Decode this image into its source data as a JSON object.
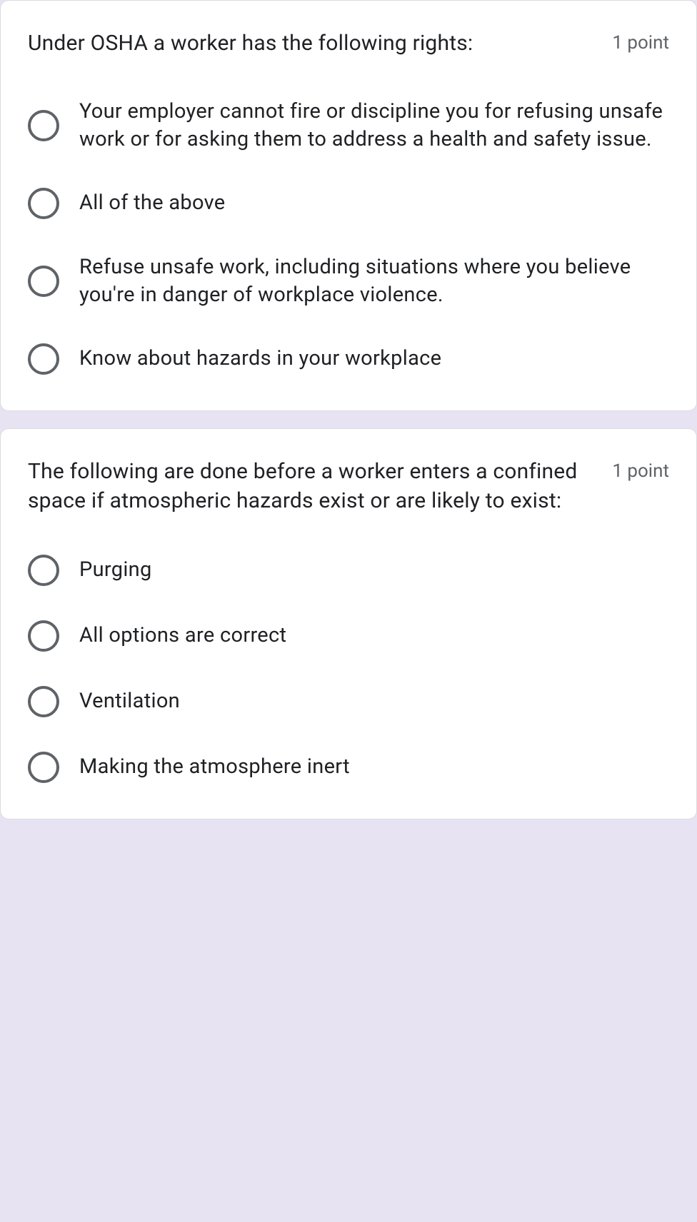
{
  "questions": [
    {
      "title": "Under OSHA a worker has the following rights:",
      "points": "1 point",
      "options": [
        "Your employer cannot fire or discipline you for refusing unsafe work or for asking them to address a health and safety issue.",
        "All of the above",
        "Refuse unsafe work, including situations where you believe you're in danger of workplace violence.",
        "Know about hazards in your workplace"
      ]
    },
    {
      "title": "The following are done before a worker enters a confined space if atmospheric hazards exist or are likely to exist:",
      "points": "1 point",
      "options": [
        "Purging",
        "All options are correct",
        "Ventilation",
        "Making the atmosphere inert"
      ]
    }
  ]
}
